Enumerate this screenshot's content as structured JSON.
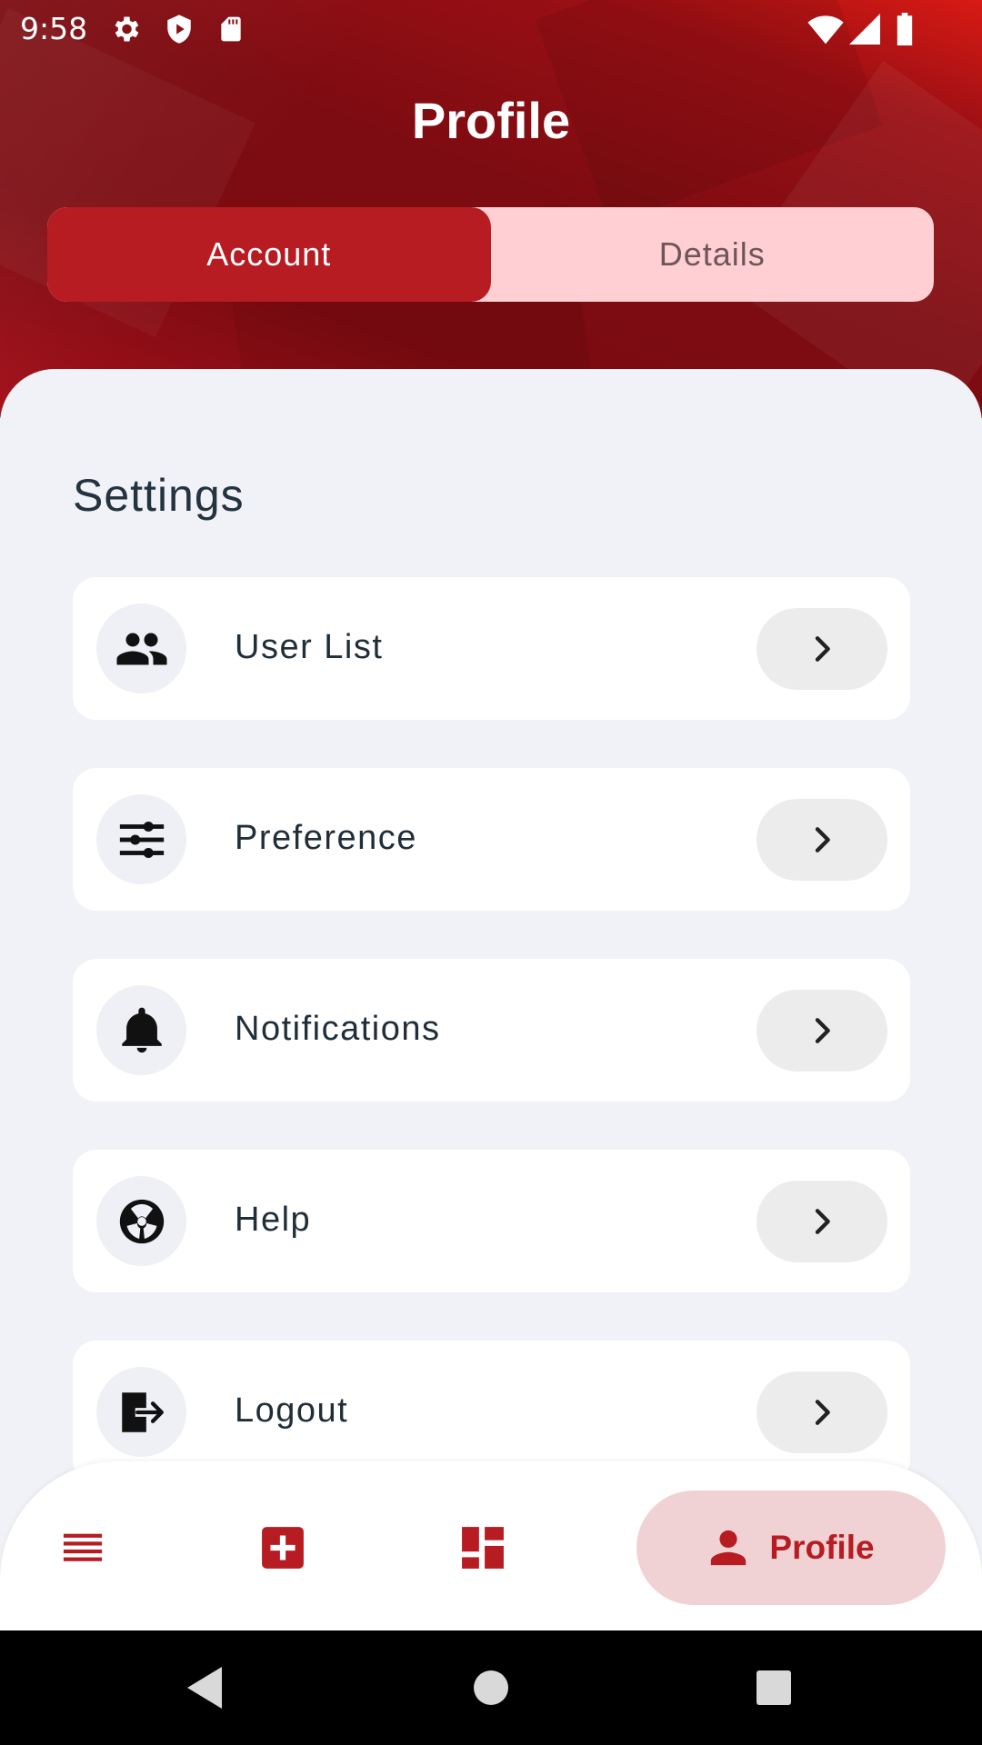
{
  "status_bar": {
    "time": "9:58",
    "left_icons": [
      "gear-icon",
      "shield-play-icon",
      "sd-card-icon"
    ],
    "right_icons": [
      "wifi-icon",
      "cellular-signal-icon",
      "battery-icon"
    ]
  },
  "header": {
    "title": "Profile",
    "tabs": [
      {
        "label": "Account",
        "active": true
      },
      {
        "label": "Details",
        "active": false
      }
    ]
  },
  "settings": {
    "title": "Settings",
    "items": [
      {
        "label": "User List",
        "icon": "users-icon"
      },
      {
        "label": "Preference",
        "icon": "sliders-icon"
      },
      {
        "label": "Notifications",
        "icon": "bell-icon"
      },
      {
        "label": "Help",
        "icon": "help-icon"
      },
      {
        "label": "Logout",
        "icon": "logout-icon"
      }
    ]
  },
  "bottom_nav": {
    "items": [
      {
        "icon": "list-icon"
      },
      {
        "icon": "add-box-icon"
      },
      {
        "icon": "dashboard-icon"
      },
      {
        "icon": "person-icon",
        "label": "Profile",
        "active": true
      }
    ]
  },
  "colors": {
    "accent": "#b71c22",
    "tab_inactive_bg": "#ffcfd3",
    "nav_active_bg": "#f1d2d4",
    "background": "#f1f2f7"
  }
}
